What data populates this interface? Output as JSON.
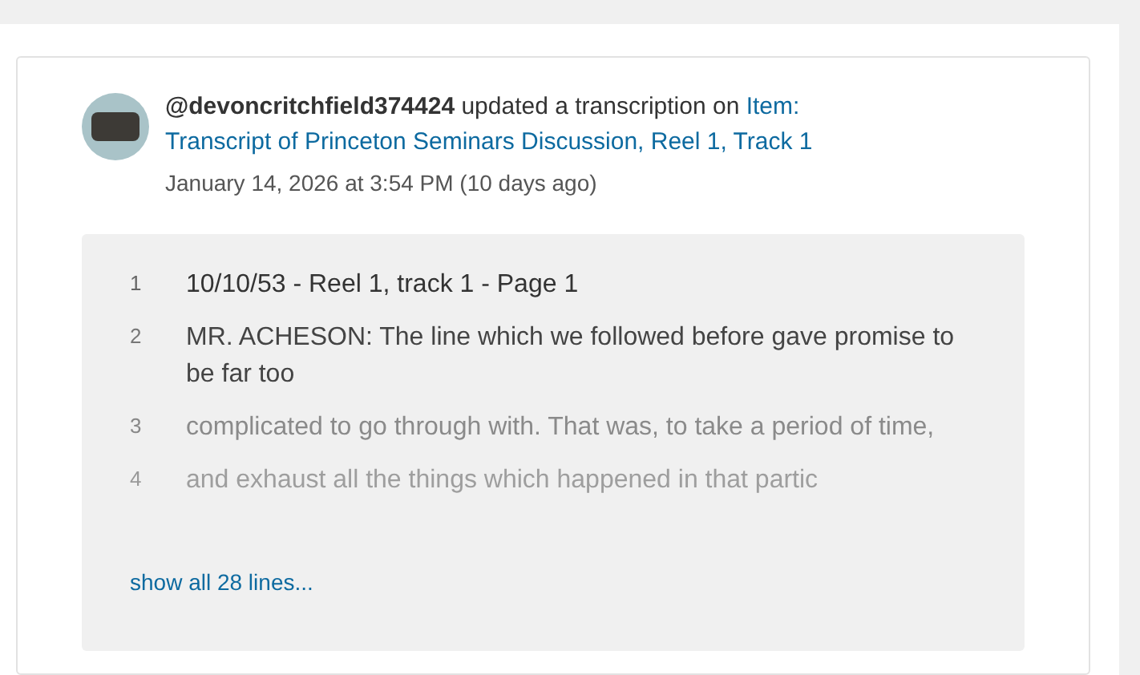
{
  "activity": {
    "user": "@devoncritchfield374424",
    "action": "updated a transcription on",
    "item_link_parts": [
      "Item:",
      "Transcript of Princeton Seminars Discussion, Reel 1, Track 1"
    ],
    "timestamp": "January 14, 2026 at 3:54 PM (10 days ago)"
  },
  "transcript": {
    "lines": [
      {
        "number": "1",
        "text": "10/10/53 - Reel 1, track 1 - Page 1"
      },
      {
        "number": "2",
        "text": "MR. ACHESON: The line which we followed before gave promise to be far too"
      },
      {
        "number": "3",
        "text": "complicated to go through with. That was, to take a period of time,"
      },
      {
        "number": "4",
        "text": "and exhaust all the things which happened in that partic"
      }
    ],
    "show_all_link": "show all 28 lines..."
  }
}
